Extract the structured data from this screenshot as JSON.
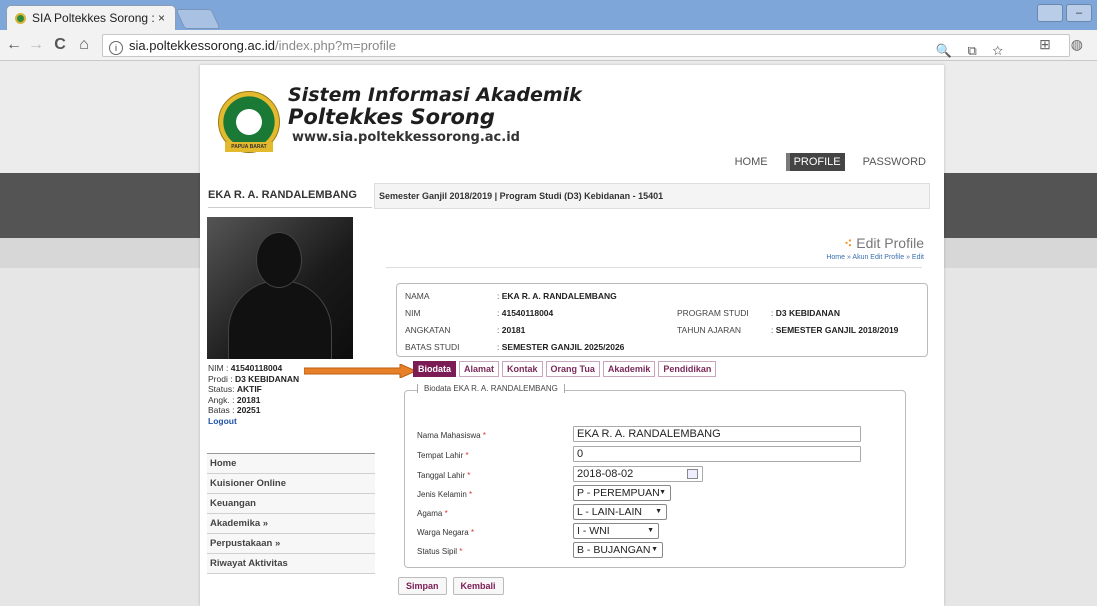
{
  "browser": {
    "tab_title": "SIA Poltekkes Sorong :",
    "tab_close": "×",
    "url_host": "sia.poltekkessorong.ac.id",
    "url_path": "/index.php?m=profile",
    "back": "←",
    "forward": "→",
    "reload": "C",
    "home": "⌂",
    "info": "i",
    "omnibox_icons": "🔍 ⧉ ☆",
    "ext_icons": "⊞ ◍",
    "win_min": "–",
    "win_other": "▭"
  },
  "header": {
    "title": "Sistem Informasi Akademik",
    "subtitle": "Poltekkes Sorong",
    "url": "www.sia.poltekkessorong.ac.id",
    "emblem_text": "PAPUA BARAT",
    "nav": [
      "HOME",
      "PROFILE",
      "PASSWORD"
    ]
  },
  "sidebar": {
    "name": "EKA R. A. RANDALEMBANG",
    "nim_label": "NIM",
    "nim": "41540118004",
    "prodi_label": "Prodi",
    "prodi": "D3 KEBIDANAN",
    "status_label": "Status:",
    "status": "AKTIF",
    "angk_label": "Angk.",
    "angk": "20181",
    "batas_label": "Batas",
    "batas": "20251",
    "logout": "Logout",
    "menu": [
      "Home",
      "Kuisioner Online",
      "Keuangan",
      "Akademika »",
      "Perpustakaan »",
      "Riwayat Aktivitas"
    ]
  },
  "main": {
    "crumbbar": "Semester Ganjil 2018/2019 | Program Studi (D3) Kebidanan - 15401",
    "page_title": "Edit Profile",
    "breadcrumb": "Home » Akun  Edit Profile » Edit",
    "info": {
      "nama_label": "NAMA",
      "nama": "EKA R. A. RANDALEMBANG",
      "nim_label": "NIM",
      "nim": "41540118004",
      "angkatan_label": "ANGKATAN",
      "angkatan": "20181",
      "batas_label": "BATAS STUDI",
      "batas": "SEMESTER GANJIL 2025/2026",
      "prodi_label": "PROGRAM STUDI",
      "prodi": "D3 KEBIDANAN",
      "ta_label": "TAHUN AJARAN",
      "ta": "SEMESTER GANJIL 2018/2019"
    },
    "tabs": [
      "Biodata",
      "Alamat",
      "Kontak",
      "Orang Tua",
      "Akademik",
      "Pendidikan"
    ],
    "legend": "Biodata EKA R. A. RANDALEMBANG",
    "fields": {
      "nama_label": "Nama Mahasiswa",
      "nama_value": "EKA R. A. RANDALEMBANG",
      "tempat_label": "Tempat Lahir",
      "tempat_value": "0",
      "tanggal_label": "Tanggal Lahir",
      "tanggal_value": "2018-08-02",
      "jk_label": "Jenis Kelamin",
      "jk_value": "P - PEREMPUAN",
      "agama_label": "Agama",
      "agama_value": "L - LAIN-LAIN",
      "wn_label": "Warga Negara",
      "wn_value": "I - WNI",
      "sipil_label": "Status Sipil",
      "sipil_value": "B - BUJANGAN"
    },
    "buttons": {
      "save": "Simpan",
      "back": "Kembali"
    }
  },
  "colors": {
    "accent": "#7b1c54",
    "arrow": "#e8802a",
    "dark_band": "#545454"
  }
}
